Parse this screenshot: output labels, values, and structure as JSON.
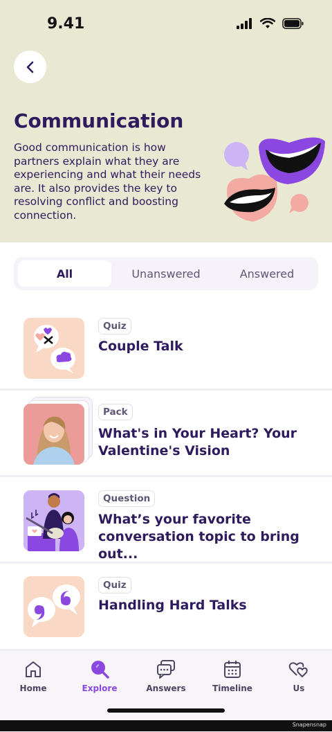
{
  "status_bar": {
    "time": "9.41"
  },
  "header": {
    "title": "Communication",
    "description": "Good communication is how partners explain what they are experiencing and what their needs are. It also provides the key to resolving conflict and boosting connection."
  },
  "tabs": [
    {
      "label": "All",
      "active": true
    },
    {
      "label": "Unanswered",
      "active": false
    },
    {
      "label": "Answered",
      "active": false
    }
  ],
  "items": [
    {
      "badge": "Quiz",
      "title": "Couple Talk"
    },
    {
      "badge": "Pack",
      "title": "What's in Your Heart? Your Valentine's Vision"
    },
    {
      "badge": "Question",
      "title": "What’s your favorite conversation topic to bring out..."
    },
    {
      "badge": "Quiz",
      "title": "Handling Hard Talks"
    }
  ],
  "bottom_nav": [
    {
      "label": "Home",
      "icon": "home-icon",
      "active": false
    },
    {
      "label": "Explore",
      "icon": "explore-icon",
      "active": true
    },
    {
      "label": "Answers",
      "icon": "answers-icon",
      "active": false
    },
    {
      "label": "Timeline",
      "icon": "calendar-icon",
      "active": false
    },
    {
      "label": "Us",
      "icon": "hearts-icon",
      "active": false
    }
  ],
  "colors": {
    "accent": "#8a48e0",
    "header_bg": "#e9e8d3",
    "text_dark": "#2d1b5e",
    "thumb_peach": "#f9d9c6"
  },
  "watermark": "Snapensnap"
}
